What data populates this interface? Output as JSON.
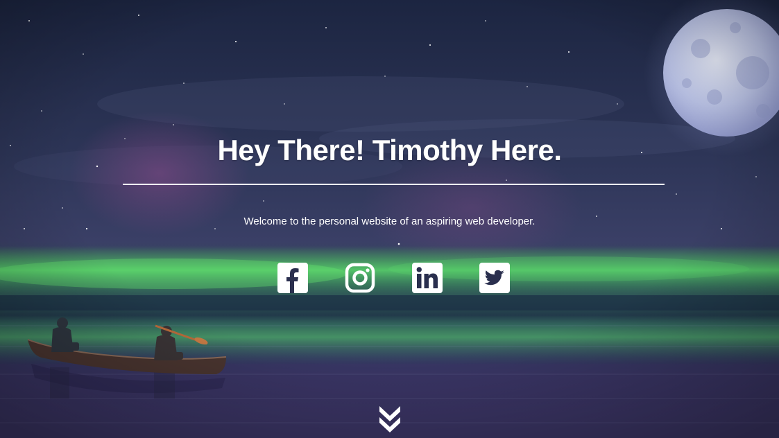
{
  "hero": {
    "title": "Hey There! Timothy Here.",
    "subtitle": "Welcome to the personal website of an aspiring web developer.",
    "background": "night-lake-aurora-moon-canoe-scene"
  },
  "social": {
    "items": [
      {
        "network": "Facebook",
        "icon": "facebook-icon"
      },
      {
        "network": "Instagram",
        "icon": "instagram-icon"
      },
      {
        "network": "LinkedIn",
        "icon": "linkedin-icon"
      },
      {
        "network": "Twitter",
        "icon": "twitter-icon"
      }
    ]
  },
  "scroll": {
    "icon": "double-chevron-down-icon"
  },
  "colors": {
    "text": "#ffffff",
    "sky_top": "#1b2440",
    "aurora": "#5fd36a",
    "water": "#2a2f55"
  }
}
